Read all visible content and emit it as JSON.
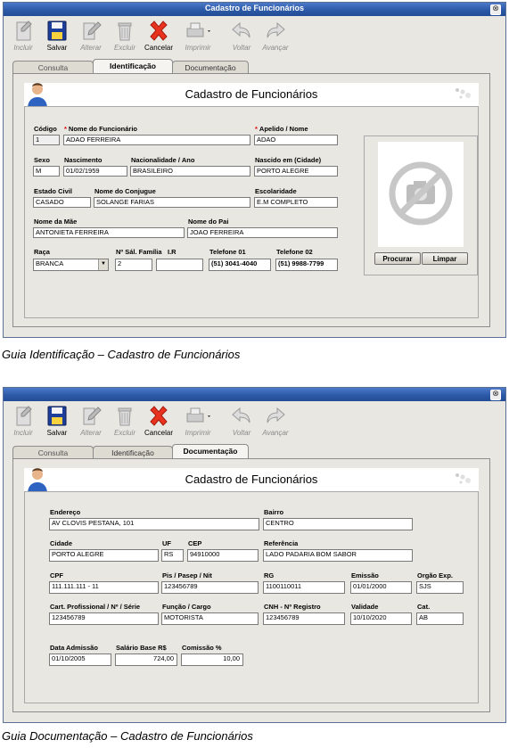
{
  "window_title": "Cadastro de Funcionários",
  "close_symbol": "⊗",
  "toolbar": {
    "incluir": "Incluir",
    "salvar": "Salvar",
    "alterar": "Alterar",
    "excluir": "Excluir",
    "cancelar": "Cancelar",
    "imprimir": "Imprimir",
    "voltar": "Voltar",
    "avancar": "Avançar"
  },
  "tabs": {
    "consulta": "Consulta",
    "identificacao": "Identificação",
    "documentacao": "Documentação"
  },
  "header_title": "Cadastro de Funcionários",
  "identificacao": {
    "labels": {
      "codigo": "Código",
      "nome": "Nome do Funcionário",
      "apelido": "Apelido / Nome",
      "sexo": "Sexo",
      "nascimento": "Nascimento",
      "nacionalidade": "Nacionalidade / Ano",
      "nascido_em": "Nascido em (Cidade)",
      "estado_civil": "Estado Civil",
      "conjugue": "Nome do Conjugue",
      "escolaridade": "Escolaridade",
      "mae": "Nome da Mãe",
      "pai": "Nome do Pai",
      "raca": "Raça",
      "sal_familia": "Nº Sál. Família",
      "ir": "I.R",
      "telefone1": "Telefone 01",
      "telefone2": "Telefone 02"
    },
    "values": {
      "codigo": "1",
      "nome": "ADAO FERREIRA",
      "apelido": "ADAO",
      "sexo": "M",
      "nascimento": "01/02/1959",
      "nacionalidade": "BRASILEIRO",
      "nascido_em": "PORTO ALEGRE",
      "estado_civil": "CASADO",
      "conjugue": "SOLANGE FARIAS",
      "escolaridade": "E.M COMPLETO",
      "mae": "ANTONIETA FERREIRA",
      "pai": "JOAO FERREIRA",
      "raca": "BRANCA",
      "sal_familia": "2",
      "ir": "",
      "telefone1": "(51) 3041-4040",
      "telefone2": "(51) 9988-7799"
    },
    "buttons": {
      "procurar": "Procurar",
      "limpar": "Limpar"
    }
  },
  "documentacao": {
    "labels": {
      "endereco": "Endereço",
      "bairro": "Bairro",
      "cidade": "Cidade",
      "uf": "UF",
      "cep": "CEP",
      "referencia": "Referência",
      "cpf": "CPF",
      "pis": "Pis / Pasep / Nit",
      "rg": "RG",
      "emissao": "Emissão",
      "orgao": "Orgão Exp.",
      "cart": "Cart. Profissional / Nº / Série",
      "funcao": "Função / Cargo",
      "cnh": "CNH - Nº Registro",
      "validade": "Validade",
      "cat": "Cat.",
      "admissao": "Data Admissão",
      "salario": "Salário Base R$",
      "comissao": "Comissão %"
    },
    "values": {
      "endereco": "AV CLOVIS PESTANA, 101",
      "bairro": "CENTRO",
      "cidade": "PORTO ALEGRE",
      "uf": "RS",
      "cep": "94910000",
      "referencia": "LADO PADARIA BOM SABOR",
      "cpf": "111.111.111 - 11",
      "pis": "123456789",
      "rg": "1100110011",
      "emissao": "01/01/2000",
      "orgao": "SJS",
      "cart": "123456789",
      "funcao": "MOTORISTA",
      "cnh": "123456789",
      "validade": "10/10/2020",
      "cat": "AB",
      "admissao": "01/10/2005",
      "salario": "724,00",
      "comissao": "10,00"
    }
  },
  "captions": {
    "identificacao": "Guia Identificação – Cadastro de Funcionários",
    "documentacao": "Guia Documentação – Cadastro de Funcionários"
  }
}
